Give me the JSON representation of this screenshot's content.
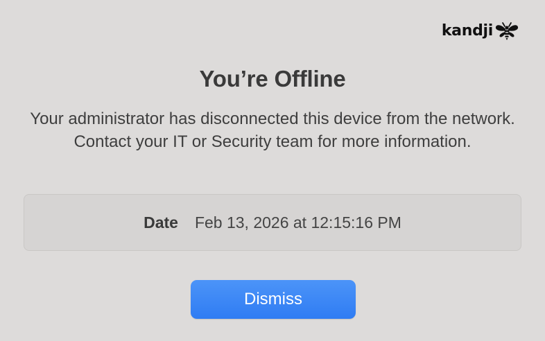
{
  "brand": {
    "name": "kandji",
    "icon": "bee-icon"
  },
  "dialog": {
    "title": "You’re Offline",
    "message": "Your administrator has disconnected this device from the network. Contact your IT or Security team for more information.",
    "date_label": "Date",
    "date_value": "Feb 13, 2026 at 12:15:16 PM",
    "dismiss_label": "Dismiss"
  },
  "colors": {
    "background": "#dddbda",
    "button": "#3a87f6",
    "button_text": "#ffffff",
    "text": "#3b3b3b"
  }
}
